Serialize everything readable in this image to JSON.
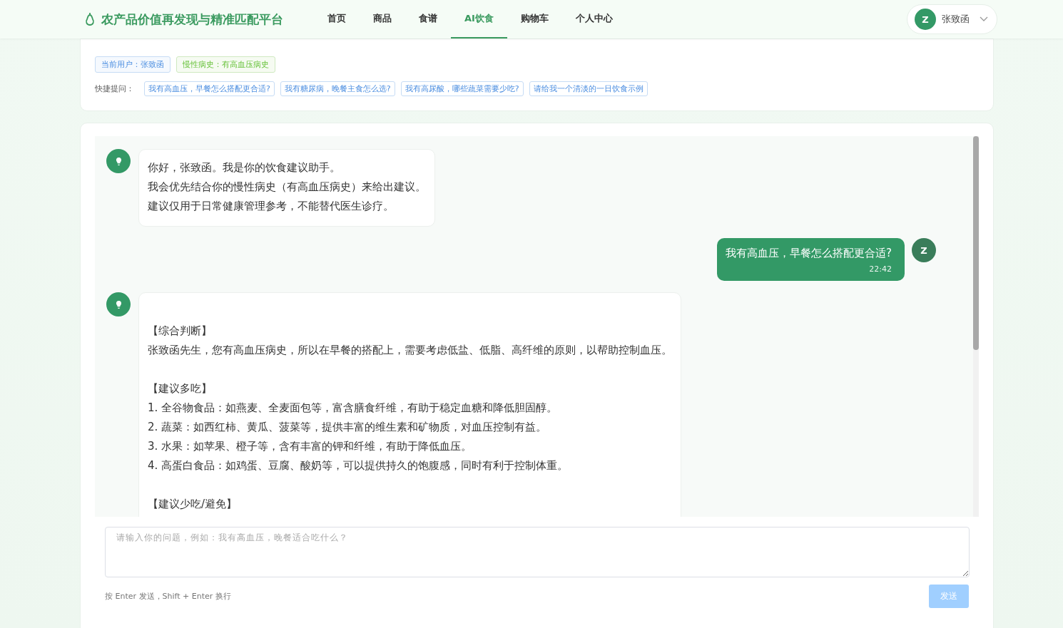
{
  "navbar": {
    "title": "农产品价值再发现与精准匹配平台",
    "items": [
      {
        "label": "首页",
        "selected": false
      },
      {
        "label": "商品",
        "selected": false
      },
      {
        "label": "食谱",
        "selected": false
      },
      {
        "label": "AI饮食",
        "selected": true
      },
      {
        "label": "购物车",
        "selected": false
      },
      {
        "label": "个人中心",
        "selected": false
      }
    ],
    "user": {
      "initial": "Z",
      "name": "张致函"
    }
  },
  "info": {
    "tags": [
      {
        "text": "当前用户：张致函",
        "kind": "user"
      },
      {
        "text": "慢性病史：有高血压病史",
        "kind": "health"
      }
    ],
    "quick_label": "快捷提问：",
    "quick_questions": [
      "我有高血压，早餐怎么搭配更合适?",
      "我有糖尿病，晚餐主食怎么选?",
      "我有高尿酸，哪些蔬菜需要少吃?",
      "请给我一个清淡的一日饮食示例"
    ]
  },
  "chat": {
    "messages": [
      {
        "kind": "assistant",
        "blocks": [
          [
            "你好，张致函。我是你的饮食建议助手。",
            "我会优先结合你的慢性病史（有高血压病史）来给出建议。",
            "建议仅用于日常健康管理参考，不能替代医生诊疗。"
          ]
        ]
      },
      {
        "kind": "user",
        "avatar": "Z",
        "text": "我有高血压，早餐怎么搭配更合适?",
        "time": "22:42"
      },
      {
        "kind": "assistant",
        "blocks": [
          [
            "【综合判断】",
            "张致函先生，您有高血压病史，所以在早餐的搭配上，需要考虑低盐、低脂、高纤维的原则，以帮助控制血压。"
          ],
          [
            "【建议多吃】",
            "1. 全谷物食品：如燕麦、全麦面包等，富含膳食纤维，有助于稳定血糖和降低胆固醇。",
            "2. 蔬菜：如西红柿、黄瓜、菠菜等，提供丰富的维生素和矿物质，对血压控制有益。",
            "3. 水果：如苹果、橙子等，含有丰富的钾和纤维，有助于降低血压。",
            "4. 高蛋白食品：如鸡蛋、豆腐、酸奶等，可以提供持久的饱腹感，同时有利于控制体重。"
          ],
          [
            "【建议少吃/避免】"
          ]
        ]
      }
    ],
    "input": {
      "placeholder": "请输入你的问题，例如：我有高血压，晚餐适合吃什么？"
    },
    "hint": "按 Enter 发送，Shift + Enter 换行",
    "send": {
      "label": "发送",
      "disabled": true
    }
  }
}
